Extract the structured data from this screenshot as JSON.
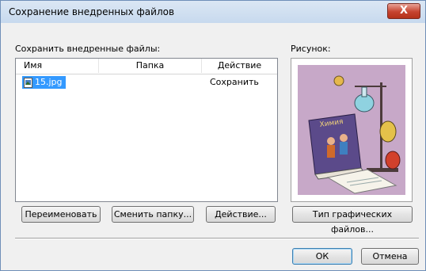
{
  "window": {
    "title": "Сохранение внедренных файлов",
    "close_symbol": "X"
  },
  "save_section": {
    "label": "Сохранить внедренные файлы:"
  },
  "table": {
    "columns": [
      "Имя",
      "Папка",
      "Действие"
    ],
    "rows": [
      {
        "name": "15.jpg",
        "folder": "",
        "action": "Сохранить",
        "selected": true
      }
    ]
  },
  "preview": {
    "label": "Рисунок:",
    "book_title": "Химия"
  },
  "buttons": {
    "rename": "Переименовать",
    "change_folder": "Сменить папку...",
    "action": "Действие...",
    "file_type": "Тип графических файлов...",
    "ok": "ОК",
    "cancel": "Отмена"
  },
  "colors": {
    "selection": "#3399ff",
    "close_button": "#c6432f",
    "title_gradient": "#c7d9ee"
  }
}
